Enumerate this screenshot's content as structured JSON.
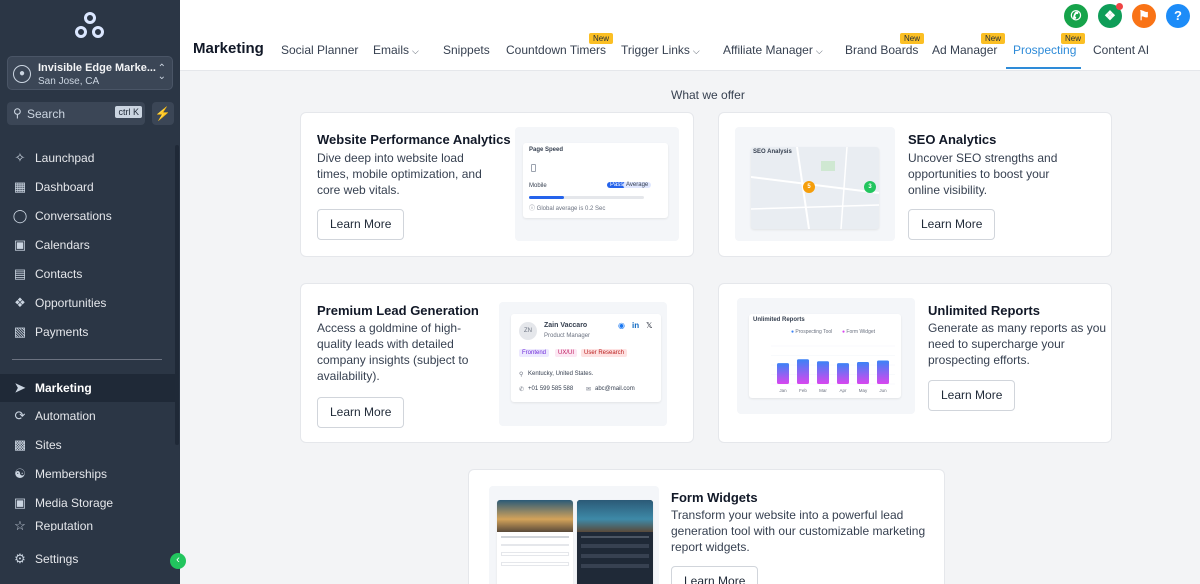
{
  "sidebar": {
    "account": {
      "name": "Invisible Edge Marke...",
      "location": "San Jose, CA"
    },
    "search": {
      "placeholder": "Search",
      "shortcut": "ctrl K"
    },
    "items": [
      {
        "label": "Launchpad",
        "icon": "rocket-icon"
      },
      {
        "label": "Dashboard",
        "icon": "grid-icon"
      },
      {
        "label": "Conversations",
        "icon": "chat-icon"
      },
      {
        "label": "Calendars",
        "icon": "calendar-icon"
      },
      {
        "label": "Contacts",
        "icon": "contacts-icon"
      },
      {
        "label": "Opportunities",
        "icon": "opportunities-icon"
      },
      {
        "label": "Payments",
        "icon": "payments-icon"
      },
      {
        "label": "Marketing",
        "icon": "send-icon"
      },
      {
        "label": "Automation",
        "icon": "automation-icon"
      },
      {
        "label": "Sites",
        "icon": "sites-icon"
      },
      {
        "label": "Memberships",
        "icon": "membership-icon"
      },
      {
        "label": "Media Storage",
        "icon": "image-icon"
      },
      {
        "label": "Reputation",
        "icon": "star-icon"
      }
    ],
    "settings": "Settings"
  },
  "header": {
    "title": "Marketing",
    "tabs": [
      {
        "label": "Social Planner"
      },
      {
        "label": "Emails"
      },
      {
        "label": "Snippets"
      },
      {
        "label": "Countdown Timers",
        "badge": "New"
      },
      {
        "label": "Trigger Links"
      },
      {
        "label": "Affiliate Manager"
      },
      {
        "label": "Brand Boards",
        "badge": "New"
      },
      {
        "label": "Ad Manager",
        "badge": "New"
      },
      {
        "label": "Prospecting",
        "badge": "New"
      },
      {
        "label": "Content AI"
      }
    ],
    "help": "?"
  },
  "colors": {
    "accent": "#2e8bd8",
    "phone": "#16a34a",
    "megaphone": "#0f9d58",
    "bell": "#f97316",
    "help": "#1d8cf8",
    "badge": "#fbbf24"
  },
  "main": {
    "section_title": "What we offer",
    "cards": [
      {
        "title": "Website Performance Analytics",
        "desc": [
          "Dive deep into website load",
          "times, mobile optimization, and",
          "core web vitals."
        ],
        "button": "Learn More",
        "preview": {
          "title": "Page Speed",
          "label": "Mobile",
          "toggle": [
            "Pass",
            "Average"
          ],
          "progress": 0.3,
          "note": "Global average is 0.2 Sec"
        }
      },
      {
        "title": "SEO Analytics",
        "desc": [
          "Uncover SEO strengths and",
          "opportunities to boost your",
          "online visibility."
        ],
        "button": "Learn More",
        "preview": {
          "title": "SEO Analysis",
          "markers": [
            "5",
            "3"
          ]
        }
      },
      {
        "title": "Premium Lead Generation",
        "desc": [
          "Access a goldmine of high-",
          "quality leads with detailed",
          "company insights (subject to",
          "availability)."
        ],
        "button": "Learn More",
        "preview": {
          "initials": "ZN",
          "name": "Zain Vaccaro",
          "role": "Product Manager",
          "tags": [
            "Frontend",
            "UX/UI",
            "User Research"
          ],
          "location": "Kentucky, United States.",
          "phone": "+01 599 585 588",
          "email": "abc@mail.com"
        }
      },
      {
        "title": "Unlimited Reports",
        "desc": [
          "Generate as many reports as you",
          "need to supercharge your",
          "prospecting efforts."
        ],
        "button": "Learn More",
        "preview": {
          "title": "Unlimited Reports",
          "legend": [
            "Prospecting Tool",
            "Form Widget"
          ],
          "months": [
            "Jan",
            "Feb",
            "Mar",
            "Apr",
            "May",
            "Jun"
          ],
          "values": [
            0.55,
            0.65,
            0.6,
            0.55,
            0.58,
            0.62
          ]
        }
      },
      {
        "title": "Form Widgets",
        "desc": [
          "Transform your website into a powerful lead",
          "generation tool with our customizable marketing",
          "report widgets."
        ],
        "button": "Learn More"
      }
    ]
  }
}
